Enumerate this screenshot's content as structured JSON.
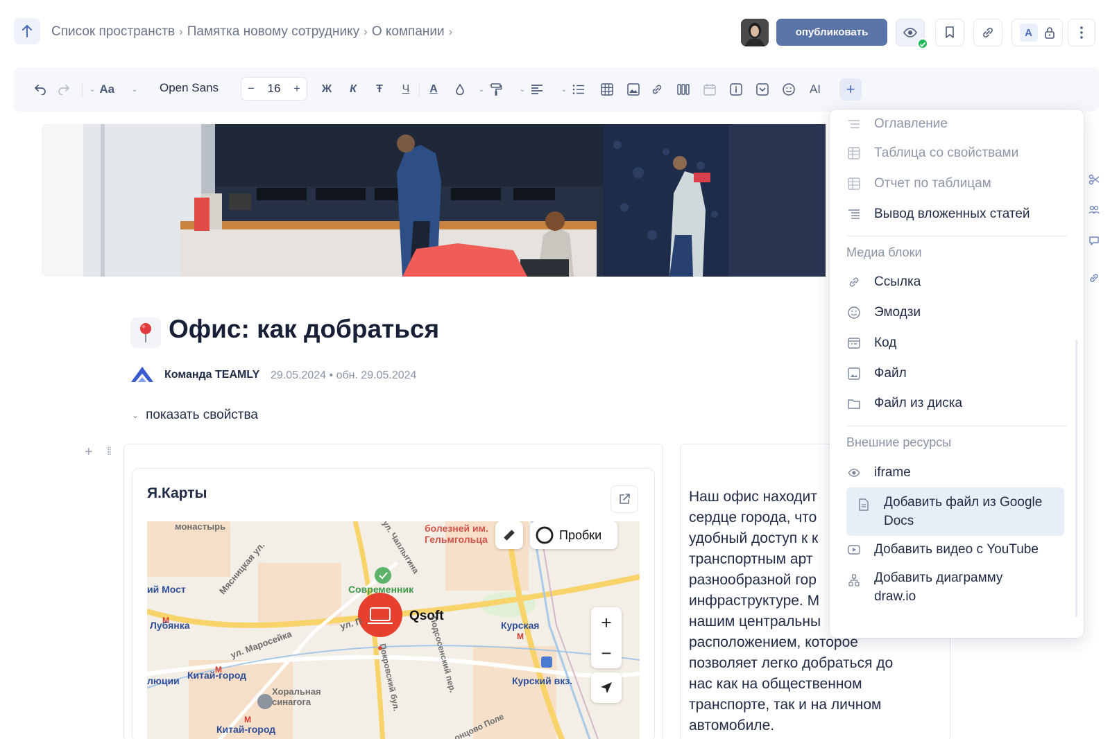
{
  "breadcrumbs": [
    "Список пространств",
    "Памятка новому сотруднику",
    "О компании"
  ],
  "header": {
    "publish_label": "опубликовать",
    "font_badge": "A"
  },
  "toolbar": {
    "text_style": "Aa",
    "font_name": "Open Sans",
    "font_size": "16",
    "bold": "Ж",
    "italic": "К",
    "strike": "Ŧ",
    "underline": "Ч",
    "color_letter": "A",
    "ai_label": "AI"
  },
  "page": {
    "title": "Офис: как добраться",
    "author": "Команда TEAMLY",
    "dates": "29.05.2024 • обн. 29.05.2024",
    "show_props": "показать свойства"
  },
  "map": {
    "title": "Я.Карты",
    "traffic": "Пробки",
    "place": "Qsoft",
    "labels": {
      "monastery": "монастырь",
      "hospital": "болезней им. Гельмгольца",
      "myasnitskaya": "Мясницкая ул.",
      "chaplygina": "ул. Чаплыгина",
      "most": "ий Мост",
      "sovremennik": "Современник",
      "lubyanka": "Лубянка",
      "ul_p": "ул. П",
      "kurskaya": "Курская",
      "maroseyka": "ул. Маросейка",
      "podsosensky": "Подсосенский пер.",
      "pokrovsky": "Покровский бул.",
      "yuchii": "люции",
      "kitay": "Китай-город",
      "synagogue": "Хоральная синагога",
      "kursky_vokz": "Курский вкз.",
      "kitay2": "Китай-город",
      "pole": "онцово Поле"
    }
  },
  "body_text": "Наш офис находит\nсердце города, что\nудобный доступ к к\nтранспортным арт\nразнообразной гор\nинфраструктуре. М\nнашим центральны\nрасположением, которое\nпозволяет легко добраться до\nнас как на общественном\nтранспорте, так и на личном\nавтомобиле.",
  "menu": {
    "items_top": [
      {
        "label": "Оглавление",
        "icon": "toc-icon",
        "disabled": true
      },
      {
        "label": "Таблица со свойствами",
        "icon": "table-props-icon",
        "disabled": true
      },
      {
        "label": "Отчет по таблицам",
        "icon": "table-report-icon",
        "disabled": true
      },
      {
        "label": "Вывод вложенных статей",
        "icon": "nested-list-icon",
        "disabled": false
      }
    ],
    "media_header": "Медиа блоки",
    "media": [
      {
        "label": "Ссылка",
        "icon": "link-icon"
      },
      {
        "label": "Эмодзи",
        "icon": "emoji-icon"
      },
      {
        "label": "Код",
        "icon": "code-icon"
      },
      {
        "label": "Файл",
        "icon": "file-icon"
      },
      {
        "label": "Файл из диска",
        "icon": "folder-icon"
      }
    ],
    "external_header": "Внешние ресурсы",
    "external": [
      {
        "label": "iframe",
        "icon": "eye-icon"
      },
      {
        "label": "Добавить файл из Google Docs",
        "line1": "Добавить файл из Google",
        "line2": "Docs",
        "icon": "google-docs-icon"
      },
      {
        "label": "Добавить видео с YouTube",
        "icon": "youtube-icon"
      },
      {
        "label": "Добавить диаграмму draw.io",
        "line1": "Добавить диаграмму",
        "line2": "draw.io",
        "icon": "diagram-icon"
      }
    ]
  },
  "colors": {
    "accent": "#5a74a8",
    "highlight": "#e8eef8",
    "map_red": "#e8402e"
  }
}
